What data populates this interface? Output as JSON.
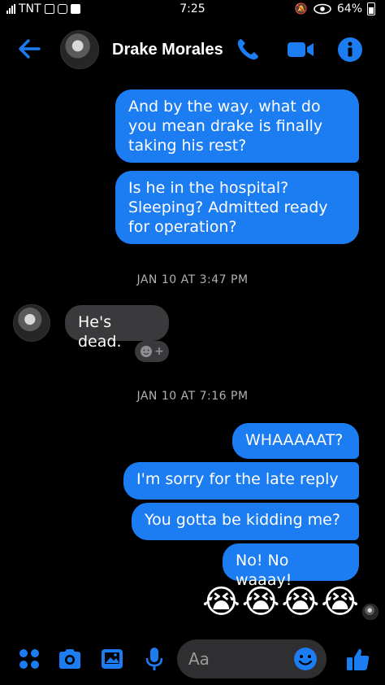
{
  "status_bar": {
    "carrier": "TNT",
    "time": "7:25",
    "battery": "64%"
  },
  "header": {
    "contact_name": "Drake Morales"
  },
  "messages": {
    "out_block1": [
      "And by the way, what do\nyou mean drake is finally\ntaking his rest?",
      "Is he in the hospital?\nSleeping? Admitted ready\nfor operation?"
    ],
    "timestamp1": "JAN 10 AT 3:47 PM",
    "incoming": "He's dead.",
    "timestamp2": "JAN 10 AT 7:16 PM",
    "out_block2": [
      "WHAAAAAT?",
      "I'm sorry for the late reply",
      "You gotta be kidding me?",
      "No! No waaay!"
    ],
    "emoji_reply": "😭😭😭😭"
  },
  "composer": {
    "placeholder": "Aa"
  },
  "colors": {
    "accent": "#1c7cf1",
    "incoming_bubble": "#3a3a3c",
    "background": "#000000"
  },
  "icons": [
    "back-arrow-icon",
    "phone-icon",
    "video-camera-icon",
    "info-icon",
    "apps-grid-icon",
    "camera-icon",
    "gallery-icon",
    "microphone-icon",
    "emoji-icon",
    "thumbs-up-icon"
  ]
}
